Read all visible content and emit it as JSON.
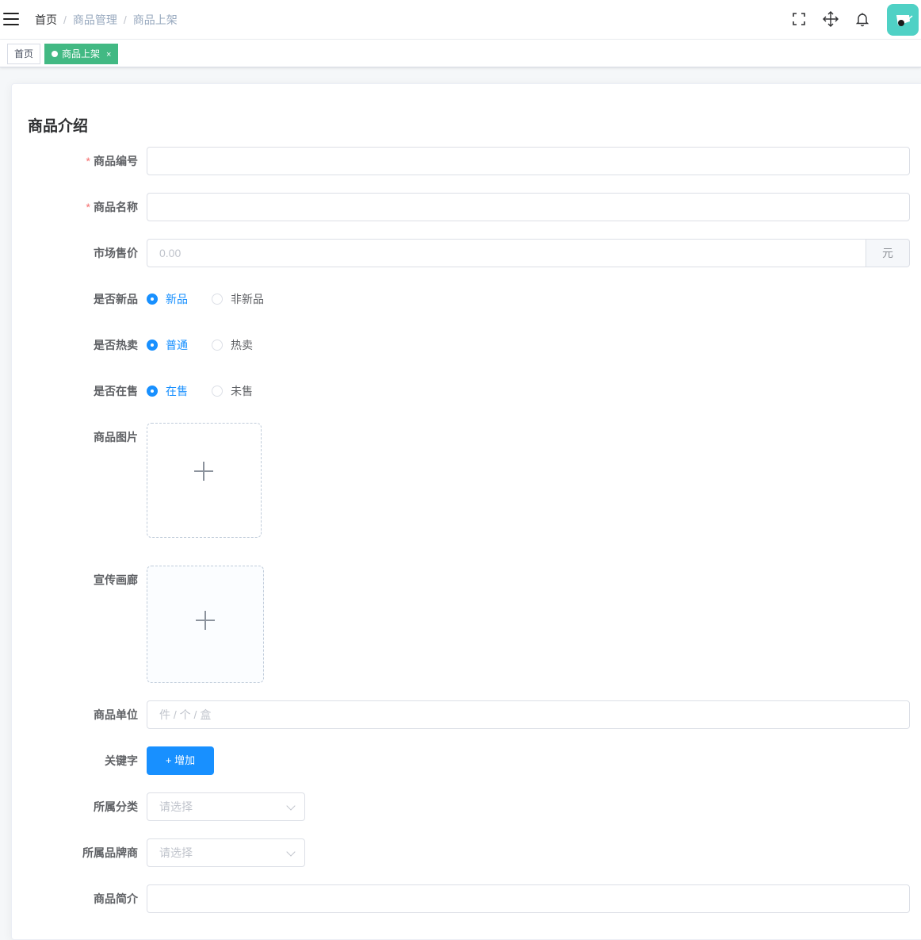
{
  "breadcrumb": [
    "首页",
    "商品管理",
    "商品上架"
  ],
  "breadcrumb_separator": "/",
  "nav_icons": [
    "menu-icon",
    "fullscreen-icon",
    "move-icon",
    "bell-icon",
    "avatar"
  ],
  "tags": {
    "home": "首页",
    "active": "商品上架",
    "active_close": "×"
  },
  "form": {
    "section_title": "商品介绍",
    "required_mark": "*",
    "product_code": {
      "label": "商品编号",
      "value": ""
    },
    "product_name": {
      "label": "商品名称",
      "value": ""
    },
    "market_price": {
      "label": "市场售价",
      "placeholder": "0.00",
      "unit": "元"
    },
    "is_new": {
      "label": "是否新品",
      "options": [
        "新品",
        "非新品"
      ],
      "selected": "新品"
    },
    "is_hot": {
      "label": "是否热卖",
      "options": [
        "普通",
        "热卖"
      ],
      "selected": "普通"
    },
    "on_sale": {
      "label": "是否在售",
      "options": [
        "在售",
        "未售"
      ],
      "selected": "在售"
    },
    "product_image": {
      "label": "商品图片"
    },
    "gallery": {
      "label": "宣传画廊"
    },
    "unit": {
      "label": "商品单位",
      "placeholder": "件 / 个 / 盒"
    },
    "keywords": {
      "label": "关键字",
      "add_button": "+ 增加"
    },
    "category": {
      "label": "所属分类",
      "placeholder": "请选择"
    },
    "brand": {
      "label": "所属品牌商",
      "placeholder": "请选择"
    },
    "brief": {
      "label": "商品简介",
      "value": ""
    }
  },
  "colors": {
    "primary": "#1890ff",
    "tag_active": "#42b983",
    "required": "#f56c6c",
    "avatar_bg": "#4fd1c5"
  }
}
